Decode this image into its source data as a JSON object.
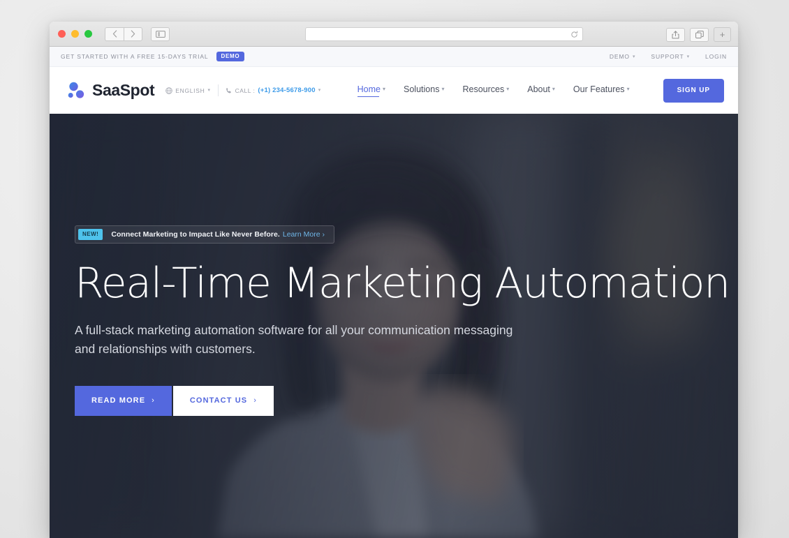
{
  "browser": {
    "traffic_lights": [
      "close",
      "minimize",
      "zoom"
    ],
    "back_icon": "chevron-left-icon",
    "forward_icon": "chevron-right-icon",
    "sidebar_icon": "sidebar-toggle-icon",
    "url_value": "",
    "url_placeholder": "",
    "reload_icon": "reload-icon",
    "share_icon": "share-icon",
    "tabs_icon": "show-tabs-icon",
    "newtab_label": "+"
  },
  "topbar": {
    "promo_text": "GET STARTED WITH A FREE 15-DAYS TRIAL",
    "demo_badge": "DEMO",
    "links": [
      {
        "label": "DEMO",
        "has_caret": true
      },
      {
        "label": "SUPPORT",
        "has_caret": true
      },
      {
        "label": "LOGIN",
        "has_caret": false
      }
    ]
  },
  "header": {
    "logo_icon": "saaspot-molecule-logo",
    "brand_name": "SaaSpot",
    "language": {
      "icon": "globe-icon",
      "label": "ENGLISH",
      "caret": "⌄"
    },
    "call": {
      "icon": "phone-icon",
      "label": "CALL :",
      "number": "(+1) 234-5678-900",
      "caret": "⌄"
    },
    "nav": [
      {
        "label": "Home",
        "active": true,
        "caret": "⌄"
      },
      {
        "label": "Solutions",
        "active": false,
        "caret": "⌄"
      },
      {
        "label": "Resources",
        "active": false,
        "caret": "⌄"
      },
      {
        "label": "About",
        "active": false,
        "caret": "⌄"
      },
      {
        "label": "Our Features",
        "active": false,
        "caret": "⌄"
      }
    ],
    "signup_label": "SIGN UP"
  },
  "hero": {
    "announcement": {
      "badge": "NEW!",
      "text": "Connect Marketing to Impact Like Never Before.",
      "link_label": "Learn More ›"
    },
    "title": "Real-Time Marketing Automation",
    "subtitle": "A full-stack marketing automation software for all your communication messaging and relationships with customers.",
    "primary_button": "READ MORE",
    "primary_button_arrow": "›",
    "secondary_button": "CONTACT US",
    "secondary_button_arrow": "›",
    "background_description": "smiling woman photo, dark navy overlay"
  },
  "colors": {
    "accent": "#5468de",
    "badge_cyan": "#4ec3ec",
    "phone_blue": "#3d9be9",
    "hero_overlay": "#232939"
  }
}
